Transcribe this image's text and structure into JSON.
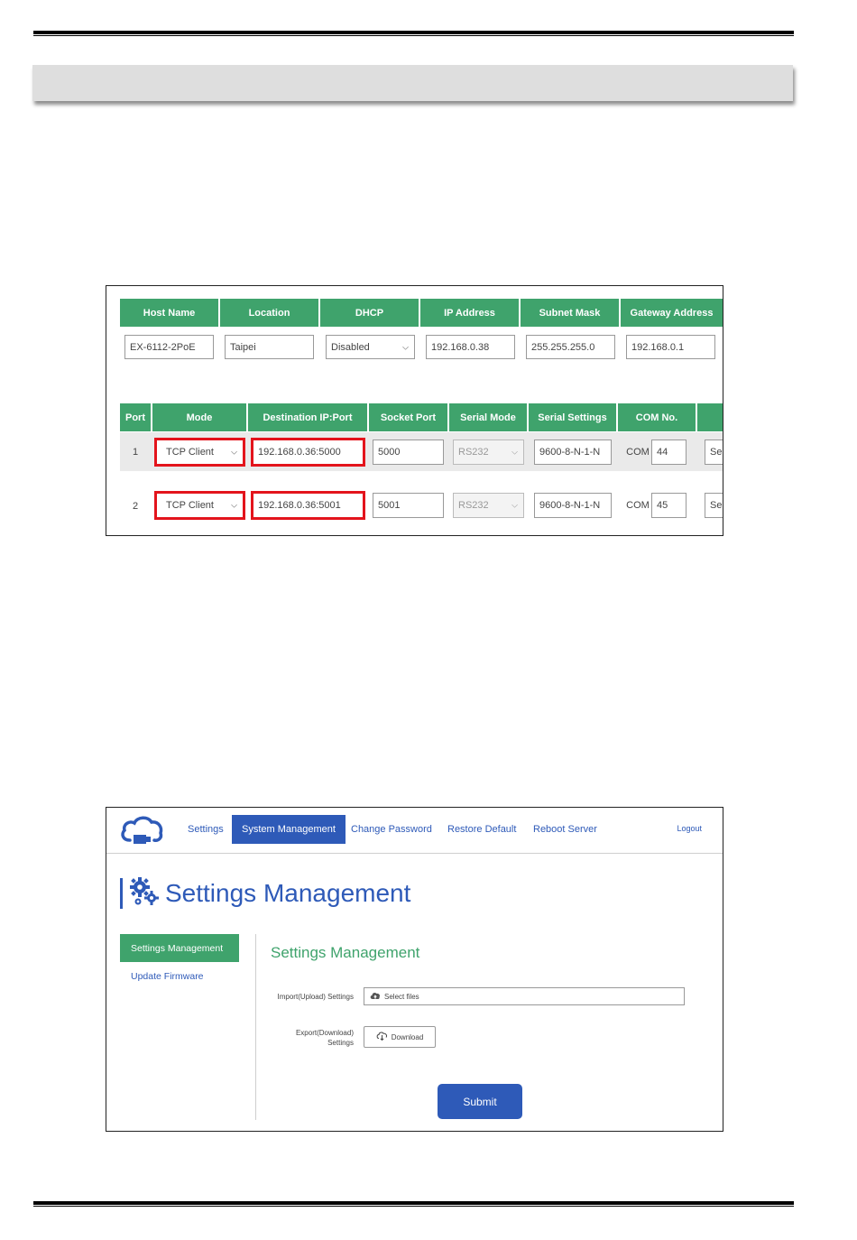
{
  "network_table": {
    "headers": [
      "Host Name",
      "Location",
      "DHCP",
      "IP Address",
      "Subnet Mask",
      "Gateway Address"
    ],
    "values": {
      "host_name": "EX-6112-2PoE",
      "location": "Taipei",
      "dhcp": "Disabled",
      "ip_address": "192.168.0.38",
      "subnet_mask": "255.255.255.0",
      "gateway_address": "192.168.0.1"
    }
  },
  "port_table": {
    "headers": [
      "Port",
      "Mode",
      "Destination IP:Port",
      "Socket Port",
      "Serial Mode",
      "Serial Settings",
      "COM No."
    ],
    "com_prefix": "COM",
    "rows": [
      {
        "port": "1",
        "mode": "TCP Client",
        "destination": "192.168.0.36:5000",
        "socket_port": "5000",
        "serial_mode": "RS232",
        "serial_settings": "9600-8-N-1-N",
        "com_no": "44",
        "extra": "Se"
      },
      {
        "port": "2",
        "mode": "TCP Client",
        "destination": "192.168.0.36:5001",
        "socket_port": "5001",
        "serial_mode": "RS232",
        "serial_settings": "9600-8-N-1-N",
        "com_no": "45",
        "extra": "Se"
      }
    ]
  },
  "web_ui": {
    "nav": {
      "items": [
        "Settings",
        "System Management",
        "Change Password",
        "Restore Default",
        "Reboot Server"
      ],
      "active": "System Management",
      "logout": "Logout"
    },
    "page_title": "Settings Management",
    "sidebar": {
      "active": "Settings Management",
      "link": "Update Firmware"
    },
    "section_title": "Settings Management",
    "import_label": "Import(Upload) Settings",
    "select_files": "Select files",
    "export_label_line1": "Export(Download)",
    "export_label_line2": "Settings",
    "download": "Download",
    "submit": "Submit",
    "colors": {
      "primary_blue": "#2e5ab8",
      "accent_green": "#3fa36c",
      "highlight_red": "#e3141c"
    },
    "icons": [
      "cloud-usb-logo-icon",
      "gears-icon",
      "cloud-upload-icon",
      "cloud-download-icon",
      "chevron-down-icon"
    ]
  }
}
